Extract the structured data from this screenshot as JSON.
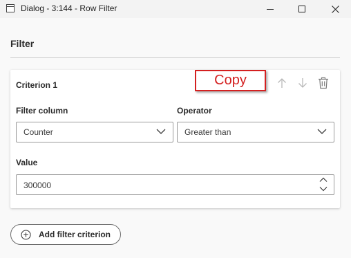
{
  "window": {
    "title": "Dialog - 3:144 - Row Filter",
    "icons": {
      "app": "app-window-icon",
      "minimize": "minimize-icon",
      "maximize": "maximize-icon",
      "close": "close-icon"
    }
  },
  "section": {
    "title": "Filter"
  },
  "criterion": {
    "title": "Criterion 1",
    "copy_label": "Copy",
    "actions": {
      "move_up": "arrow-up-icon",
      "move_down": "arrow-down-icon",
      "delete": "trash-icon"
    },
    "filter_column": {
      "label": "Filter column",
      "value": "Counter"
    },
    "operator": {
      "label": "Operator",
      "value": "Greater than"
    },
    "value": {
      "label": "Value",
      "value": "300000"
    }
  },
  "add_button": {
    "label": "Add filter criterion",
    "icon": "plus-circle-icon"
  },
  "colors": {
    "copy_accent": "#d42020",
    "disabled_icon": "#b8b8b8",
    "background": "#f9f9f9"
  }
}
